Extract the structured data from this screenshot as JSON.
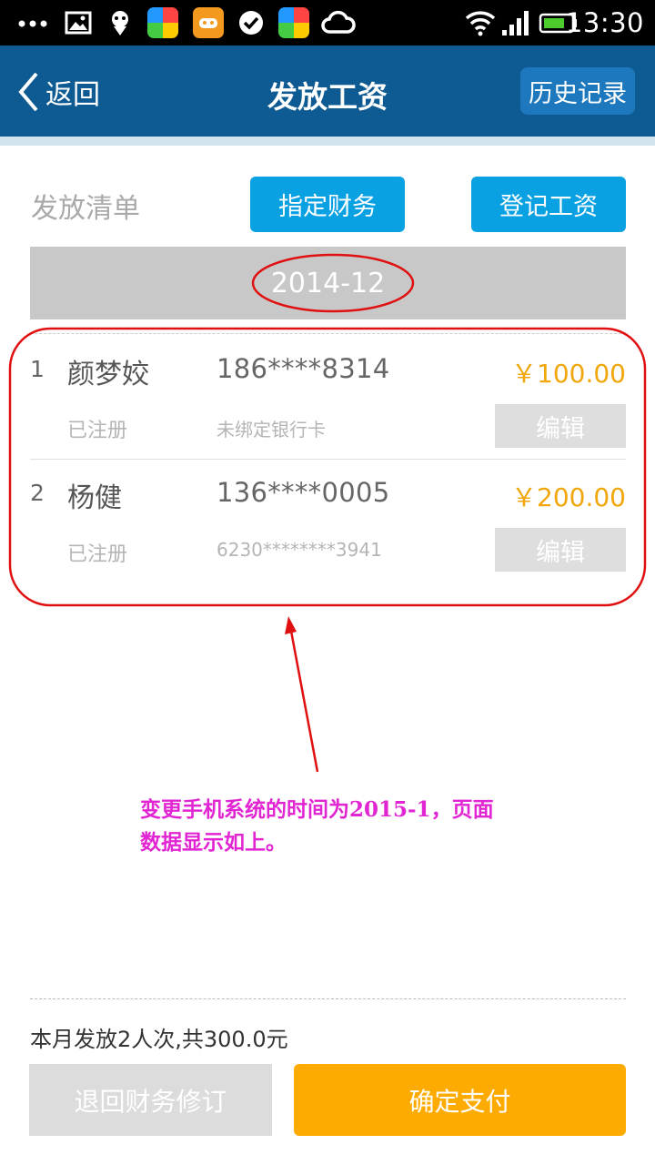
{
  "status_bar": {
    "time": "13:30",
    "icons": [
      "more-dots-icon",
      "image-icon",
      "alien-icon",
      "app-tile-icon",
      "gamepad-icon",
      "check-circle-icon",
      "app-tile-icon",
      "cloud-icon",
      "wifi-icon",
      "signal-icon",
      "battery-icon"
    ]
  },
  "header": {
    "back_label": "返回",
    "title": "发放工资",
    "history_label": "历史记录"
  },
  "toolbar": {
    "list_label": "发放清单",
    "assign_finance_label": "指定财务",
    "register_salary_label": "登记工资"
  },
  "month": "2014-12",
  "rows": [
    {
      "index": "1",
      "name": "颜梦姣",
      "phone": "186****8314",
      "amount": "￥100.00",
      "status": "已注册",
      "bank": "未绑定银行卡",
      "edit_label": "编辑"
    },
    {
      "index": "2",
      "name": "杨健",
      "phone": "136****0005",
      "amount": "￥200.00",
      "status": "已注册",
      "bank": "6230********3941",
      "edit_label": "编辑"
    }
  ],
  "annotation": {
    "note": "变更手机系统的时间为2015-1，页面数据显示如上。",
    "color": "#e225d3",
    "marker_color": "#e01010"
  },
  "footer": {
    "summary": "本月发放2人次,共300.0元",
    "revert_label": "退回财务修订",
    "pay_label": "确定支付"
  },
  "colors": {
    "nav": "#0e5b93",
    "accent_blue": "#0aa1e3",
    "amount": "#f1a60b",
    "pay": "#fdab00"
  }
}
